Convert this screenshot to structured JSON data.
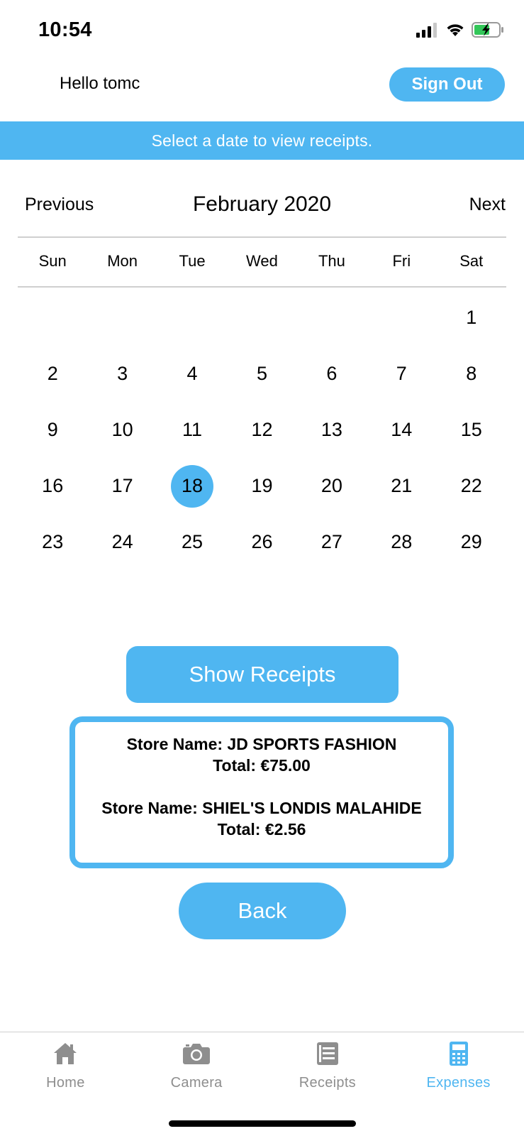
{
  "status_bar": {
    "time": "10:54",
    "icons": [
      "signal-icon",
      "wifi-icon",
      "battery-charging-icon"
    ],
    "battery_color": "#33c759"
  },
  "header": {
    "greeting": "Hello tomc",
    "sign_out_label": "Sign Out"
  },
  "banner": {
    "text": "Select a date to view receipts."
  },
  "calendar": {
    "previous_label": "Previous",
    "month_title": "February 2020",
    "next_label": "Next",
    "weekdays": [
      "Sun",
      "Mon",
      "Tue",
      "Wed",
      "Thu",
      "Fri",
      "Sat"
    ],
    "weeks": [
      [
        "",
        "",
        "",
        "",
        "",
        "",
        "1"
      ],
      [
        "2",
        "3",
        "4",
        "5",
        "6",
        "7",
        "8"
      ],
      [
        "9",
        "10",
        "11",
        "12",
        "13",
        "14",
        "15"
      ],
      [
        "16",
        "17",
        "18",
        "19",
        "20",
        "21",
        "22"
      ],
      [
        "23",
        "24",
        "25",
        "26",
        "27",
        "28",
        "29"
      ]
    ],
    "selected_day": "18"
  },
  "actions": {
    "show_receipts_label": "Show Receipts",
    "back_label": "Back"
  },
  "receipts": [
    {
      "store_line": "Store Name: JD SPORTS FASHION",
      "total_line": "Total: €75.00"
    },
    {
      "store_line": "Store Name: SHIEL'S LONDIS MALAHIDE",
      "total_line": "Total: €2.56"
    }
  ],
  "tabbar": {
    "tabs": [
      {
        "label": "Home",
        "icon": "home-icon",
        "active": false
      },
      {
        "label": "Camera",
        "icon": "camera-icon",
        "active": false
      },
      {
        "label": "Receipts",
        "icon": "receipts-icon",
        "active": false
      },
      {
        "label": "Expenses",
        "icon": "calculator-icon",
        "active": true
      }
    ]
  },
  "colors": {
    "accent": "#4fb6f1",
    "tab_inactive": "#8e8e8e",
    "divider": "#cfcfcf"
  }
}
